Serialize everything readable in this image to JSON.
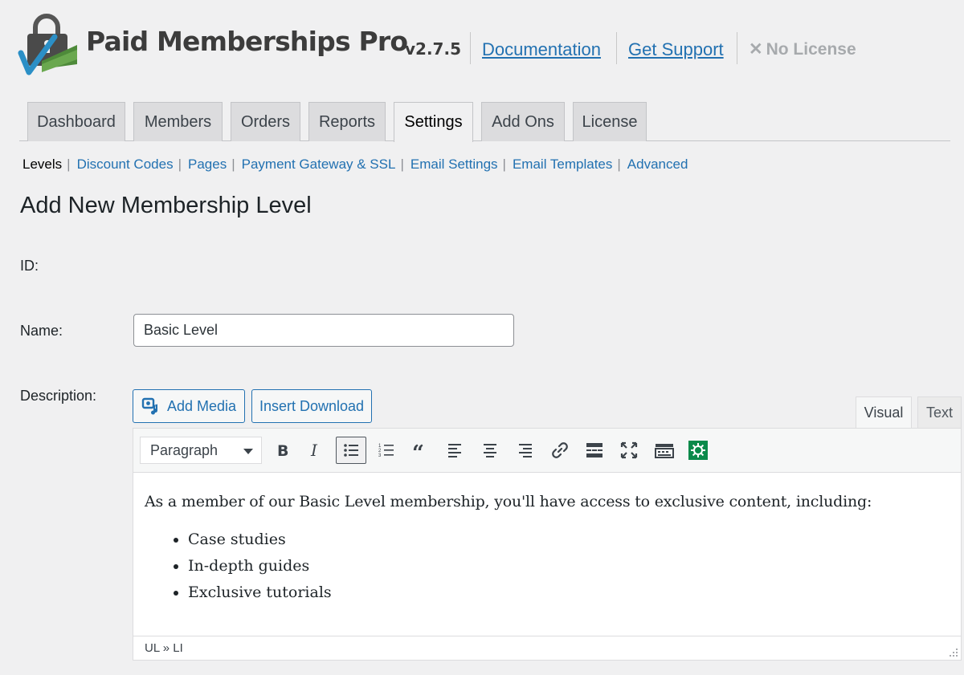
{
  "header": {
    "brand": "Paid Memberships Pro",
    "version": "v2.7.5",
    "links": [
      "Documentation",
      "Get Support"
    ],
    "license_status": "No License"
  },
  "tabs": [
    {
      "label": "Dashboard",
      "active": false
    },
    {
      "label": "Members",
      "active": false
    },
    {
      "label": "Orders",
      "active": false
    },
    {
      "label": "Reports",
      "active": false
    },
    {
      "label": "Settings",
      "active": true
    },
    {
      "label": "Add Ons",
      "active": false
    },
    {
      "label": "License",
      "active": false
    }
  ],
  "subnav": [
    "Levels",
    "Discount Codes",
    "Pages",
    "Payment Gateway & SSL",
    "Email Settings",
    "Email Templates",
    "Advanced"
  ],
  "page_title": "Add New Membership Level",
  "form": {
    "id_label": "ID:",
    "name_label": "Name:",
    "name_value": "Basic Level",
    "description_label": "Description:"
  },
  "editor": {
    "add_media_label": "Add Media",
    "insert_download_label": "Insert Download",
    "mode_tabs": [
      "Visual",
      "Text"
    ],
    "active_mode": "Visual",
    "format_value": "Paragraph",
    "toolbar_icons": [
      "bold-icon",
      "italic-icon",
      "bullet-list-icon",
      "numbered-list-icon",
      "blockquote-icon",
      "align-left-icon",
      "align-center-icon",
      "align-right-icon",
      "link-icon",
      "read-more-icon",
      "fullscreen-icon",
      "toolbar-toggle-icon",
      "plugin-gear-icon"
    ],
    "paragraph": "As a member of our Basic Level membership, you'll have access to exclusive content, including:",
    "list_items": [
      "Case studies",
      "In-depth guides",
      "Exclusive tutorials"
    ],
    "path": "UL » LI"
  },
  "colors": {
    "link": "#2271b1",
    "plugin_green": "#0a8a4a",
    "logo_green": "#4e8a3a",
    "logo_blue": "#2b8fc6"
  }
}
